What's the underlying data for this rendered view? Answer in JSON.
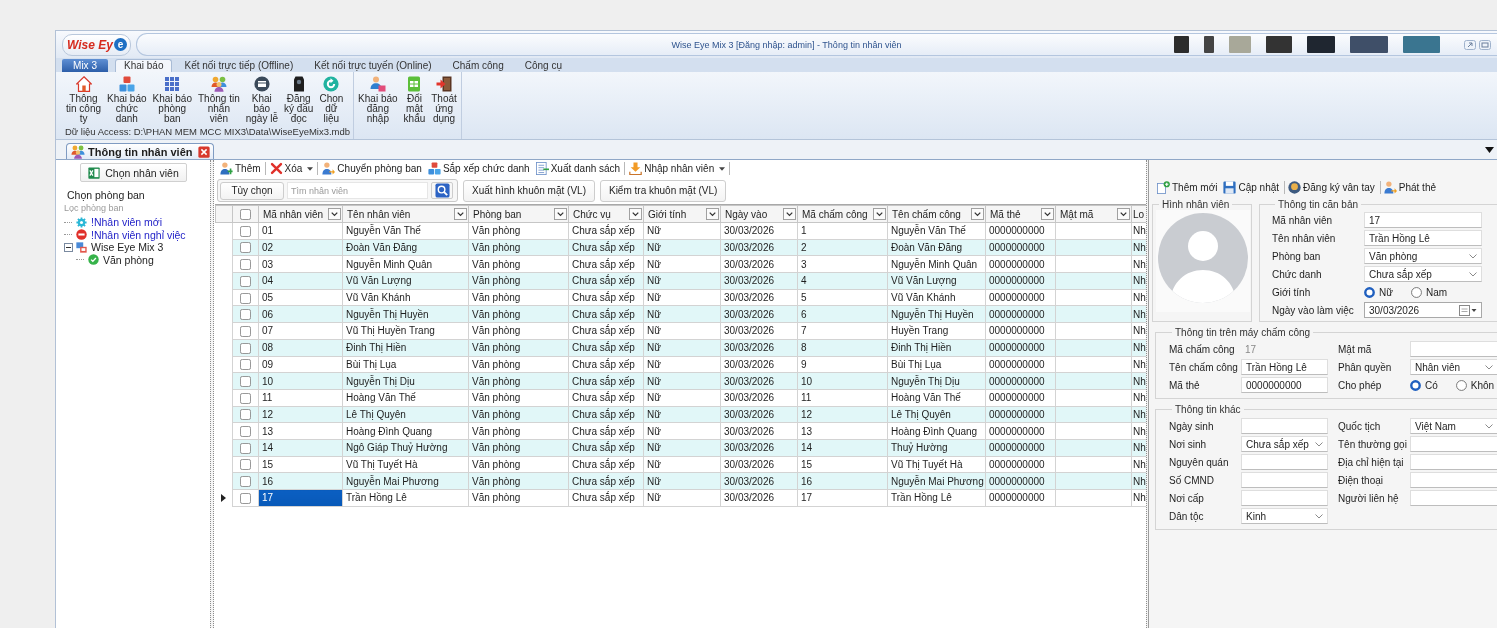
{
  "title_bar": {
    "logo": {
      "text": "Wise Ey",
      "badge": "e"
    },
    "title": "Wise Eye Mix 3 [Đăng nhập: admin] - Thông tin nhân viên"
  },
  "ribbon_tabs": [
    {
      "label": "Mix 3",
      "kind": "app",
      "selected": false
    },
    {
      "label": "Khai báo",
      "kind": "tab",
      "selected": true
    },
    {
      "label": "Kết nối trực tiếp (Offline)",
      "kind": "tab",
      "selected": false
    },
    {
      "label": "Kết nối trực tuyến (Online)",
      "kind": "tab",
      "selected": false
    },
    {
      "label": "Chấm công",
      "kind": "tab",
      "selected": false
    },
    {
      "label": "Công cụ",
      "kind": "tab",
      "selected": false
    }
  ],
  "ribbon_groups": [
    {
      "caption": "Dữ liệu Access: D:\\PHAN MEM MCC MIX3\\Data\\WiseEyeMix3.mdb",
      "buttons": [
        "Thông\ntin công\nty",
        "Khai báo\nchức\ndanh",
        "Khai báo\nphòng\nban",
        "Thông tin\nnhân\nviên",
        "Khai\nbáo\nngày lễ",
        "Đăng\nký đầu\nđọc",
        "Chọn\ndữ\nliệu"
      ]
    },
    {
      "buttons": [
        "Khai báo\nđăng\nnhập",
        "Đổi\nmật\nkhẩu",
        "Thoát\nứng\ndụng"
      ]
    }
  ],
  "doc_tabs": [
    {
      "label": "Thông tin nhân viên",
      "selected": true
    }
  ],
  "left_panel": {
    "button": "Chọn nhân viên",
    "heading": "Chọn phòng ban",
    "filter": {
      "placeholder": "Lọc phòng ban"
    },
    "tree": [
      {
        "label": "!Nhân viên mới",
        "kind": "new"
      },
      {
        "label": "!Nhân viên nghỉ việc",
        "kind": "inactive"
      },
      {
        "label": "Wise Eye Mix 3",
        "kind": "company",
        "expanded": true,
        "children": [
          {
            "label": "Văn phòng",
            "kind": "department"
          }
        ]
      }
    ]
  },
  "toolbar": [
    {
      "label": "Thêm",
      "dropdown": false,
      "separator_after": true
    },
    {
      "label": "Xóa",
      "dropdown": true,
      "separator_after": true
    },
    {
      "label": "Chuyển phòng ban",
      "dropdown": false,
      "separator_after": false
    },
    {
      "label": "Sắp xếp chức danh",
      "dropdown": false,
      "separator_after": false
    },
    {
      "label": "Xuất danh sách",
      "dropdown": false,
      "separator_after": true
    },
    {
      "label": "Nhập nhân viên",
      "dropdown": true,
      "separator_after": true
    }
  ],
  "search_bar": {
    "options_button": "Tùy chọn",
    "search": {
      "placeholder": "Tìm nhân viên"
    },
    "buttons": [
      "Xuất hình khuôn mặt (VL)",
      "Kiểm tra khuôn mặt (VL)"
    ]
  },
  "grid": {
    "all_checked": false,
    "columns": [
      "Mã nhân viên",
      "Tên nhân viên",
      "Phòng ban",
      "Chức vụ",
      "Giới tính",
      "Ngày vào",
      "Mã chấm công",
      "Tên chấm công",
      "Mã thẻ",
      "Mật mã",
      "Lo"
    ],
    "rows": [
      {
        "checked": false,
        "selected": false,
        "cells": [
          "01",
          "Nguyễn Văn Thế",
          "Văn phòng",
          "Chưa sắp xếp",
          "Nữ",
          "30/03/2026",
          "1",
          "Nguyễn Văn Thế",
          "0000000000",
          null,
          "Nh"
        ]
      },
      {
        "checked": false,
        "selected": false,
        "cells": [
          "02",
          "Đoàn Văn Đăng",
          "Văn phòng",
          "Chưa sắp xếp",
          "Nữ",
          "30/03/2026",
          "2",
          "Đoàn Văn Đăng",
          "0000000000",
          null,
          "Nh"
        ]
      },
      {
        "checked": false,
        "selected": false,
        "cells": [
          "03",
          "Nguyễn Minh Quân",
          "Văn phòng",
          "Chưa sắp xếp",
          "Nữ",
          "30/03/2026",
          "3",
          "Nguyễn Minh Quân",
          "0000000000",
          null,
          "Nh"
        ]
      },
      {
        "checked": false,
        "selected": false,
        "cells": [
          "04",
          "Vũ Văn Lượng",
          "Văn phòng",
          "Chưa sắp xếp",
          "Nữ",
          "30/03/2026",
          "4",
          "Vũ Văn Lượng",
          "0000000000",
          null,
          "Nh"
        ]
      },
      {
        "checked": false,
        "selected": false,
        "cells": [
          "05",
          "Vũ Văn Khánh",
          "Văn phòng",
          "Chưa sắp xếp",
          "Nữ",
          "30/03/2026",
          "5",
          "Vũ Văn Khánh",
          "0000000000",
          null,
          "Nh"
        ]
      },
      {
        "checked": false,
        "selected": false,
        "cells": [
          "06",
          "Nguyễn Thị Huyền",
          "Văn phòng",
          "Chưa sắp xếp",
          "Nữ",
          "30/03/2026",
          "6",
          "Nguyễn Thị Huyền",
          "0000000000",
          null,
          "Nh"
        ]
      },
      {
        "checked": false,
        "selected": false,
        "cells": [
          "07",
          "Vũ Thị Huyền Trang",
          "Văn phòng",
          "Chưa sắp xếp",
          "Nữ",
          "30/03/2026",
          "7",
          "Huyền Trang",
          "0000000000",
          null,
          "Nh"
        ]
      },
      {
        "checked": false,
        "selected": false,
        "cells": [
          "08",
          "Đinh Thị Hiền",
          "Văn phòng",
          "Chưa sắp xếp",
          "Nữ",
          "30/03/2026",
          "8",
          "Đinh Thị Hiền",
          "0000000000",
          null,
          "Nh"
        ]
      },
      {
        "checked": false,
        "selected": false,
        "cells": [
          "09",
          "Bùi Thị Lụa",
          "Văn phòng",
          "Chưa sắp xếp",
          "Nữ",
          "30/03/2026",
          "9",
          "Bùi Thị Lụa",
          "0000000000",
          null,
          "Nh"
        ]
      },
      {
        "checked": false,
        "selected": false,
        "cells": [
          "10",
          "Nguyễn Thị Dịu",
          "Văn phòng",
          "Chưa sắp xếp",
          "Nữ",
          "30/03/2026",
          "10",
          "Nguyễn Thị Dịu",
          "0000000000",
          null,
          "Nh"
        ]
      },
      {
        "checked": false,
        "selected": false,
        "cells": [
          "11",
          "Hoàng Văn Thế",
          "Văn phòng",
          "Chưa sắp xếp",
          "Nữ",
          "30/03/2026",
          "11",
          "Hoàng Văn Thế",
          "0000000000",
          null,
          "Nh"
        ]
      },
      {
        "checked": false,
        "selected": false,
        "cells": [
          "12",
          "Lê Thị Quyên",
          "Văn phòng",
          "Chưa sắp xếp",
          "Nữ",
          "30/03/2026",
          "12",
          "Lê Thị Quyên",
          "0000000000",
          null,
          "Nh"
        ]
      },
      {
        "checked": false,
        "selected": false,
        "cells": [
          "13",
          "Hoàng Đình Quang",
          "Văn phòng",
          "Chưa sắp xếp",
          "Nữ",
          "30/03/2026",
          "13",
          "Hoàng Đình Quang",
          "0000000000",
          null,
          "Nh"
        ]
      },
      {
        "checked": false,
        "selected": false,
        "cells": [
          "14",
          "Ngô Giáp Thuỷ Hường",
          "Văn phòng",
          "Chưa sắp xếp",
          "Nữ",
          "30/03/2026",
          "14",
          "Thuỷ Hường",
          "0000000000",
          null,
          "Nh"
        ]
      },
      {
        "checked": false,
        "selected": false,
        "cells": [
          "15",
          "Vũ Thị Tuyết Hà",
          "Văn phòng",
          "Chưa sắp xếp",
          "Nữ",
          "30/03/2026",
          "15",
          "Vũ Thị Tuyết Hà",
          "0000000000",
          null,
          "Nh"
        ]
      },
      {
        "checked": false,
        "selected": false,
        "cells": [
          "16",
          "Nguyễn Mai Phương",
          "Văn phòng",
          "Chưa sắp xếp",
          "Nữ",
          "30/03/2026",
          "16",
          "Nguyễn Mai Phương",
          "0000000000",
          null,
          "Nh"
        ]
      },
      {
        "checked": false,
        "selected": true,
        "cells": [
          "17",
          "Trần Hồng Lê",
          "Văn phòng",
          "Chưa sắp xếp",
          "Nữ",
          "30/03/2026",
          "17",
          "Trần Hồng Lê",
          "0000000000",
          null,
          "Nh"
        ]
      }
    ]
  },
  "detail_toolbar": [
    {
      "label": "Thêm mới",
      "separator_after": false
    },
    {
      "label": "Cập nhật",
      "separator_after": true
    },
    {
      "label": "Đăng ký vân tay",
      "separator_after": true
    },
    {
      "label": "Phát thẻ",
      "separator_after": false
    }
  ],
  "photo_group": {
    "title": "Hình nhân viên"
  },
  "basic_info": {
    "title": "Thông tin căn bản",
    "fields": [
      {
        "label": "Mã nhân viên",
        "kind": "text",
        "value": "17"
      },
      {
        "label": "Tên nhân viên",
        "kind": "text",
        "value": "Trần Hồng Lê"
      },
      {
        "label": "Phòng ban",
        "kind": "select",
        "value": "Văn phòng"
      },
      {
        "label": "Chức danh",
        "kind": "select",
        "value": "Chưa sắp xếp"
      },
      {
        "label": "Giới tính",
        "kind": "radio",
        "options": [
          {
            "label": "Nữ",
            "selected": true
          },
          {
            "label": "Nam",
            "selected": false
          }
        ]
      },
      {
        "label": "Ngày vào làm việc",
        "kind": "date",
        "value": "30/03/2026"
      }
    ]
  },
  "device_info": {
    "title": "Thông tin trên máy chấm công",
    "columns": [
      {
        "fields": [
          {
            "label": "Mã chấm công",
            "kind": "readonly",
            "value": "17"
          },
          {
            "label": "Tên chấm công",
            "kind": "text",
            "value": "Trần Hồng Lê"
          },
          {
            "label": "Mã thẻ",
            "kind": "text",
            "value": "0000000000"
          }
        ]
      },
      {
        "fields": [
          {
            "label": "Mật mã",
            "kind": "text"
          },
          {
            "label": "Phân quyền",
            "kind": "select",
            "value": "Nhân viên"
          },
          {
            "label": "Cho phép",
            "kind": "radio",
            "options": [
              {
                "label": "Có",
                "selected": true
              },
              {
                "label": "Khôn",
                "selected": false
              }
            ]
          }
        ]
      }
    ]
  },
  "other_info": {
    "title": "Thông tin khác",
    "columns": [
      {
        "fields": [
          {
            "label": "Ngày sinh",
            "kind": "text"
          },
          {
            "label": "Nơi sinh",
            "kind": "select",
            "value": "Chưa sắp xếp"
          },
          {
            "label": "Nguyên quán",
            "kind": "text"
          },
          {
            "label": "Số CMND",
            "kind": "text"
          },
          {
            "label": "Nơi cấp",
            "kind": "text"
          },
          {
            "label": "Dân tộc",
            "kind": "select",
            "value": "Kinh"
          }
        ]
      },
      {
        "fields": [
          {
            "label": "Quốc tịch",
            "kind": "select",
            "value": "Việt Nam"
          },
          {
            "label": "Tên thường gọi",
            "kind": "text"
          },
          {
            "label": "Địa chỉ hiện tại",
            "kind": "text"
          },
          {
            "label": "Điện thoại",
            "kind": "text"
          },
          {
            "label": "Người liên hệ",
            "kind": "text"
          }
        ]
      }
    ]
  }
}
